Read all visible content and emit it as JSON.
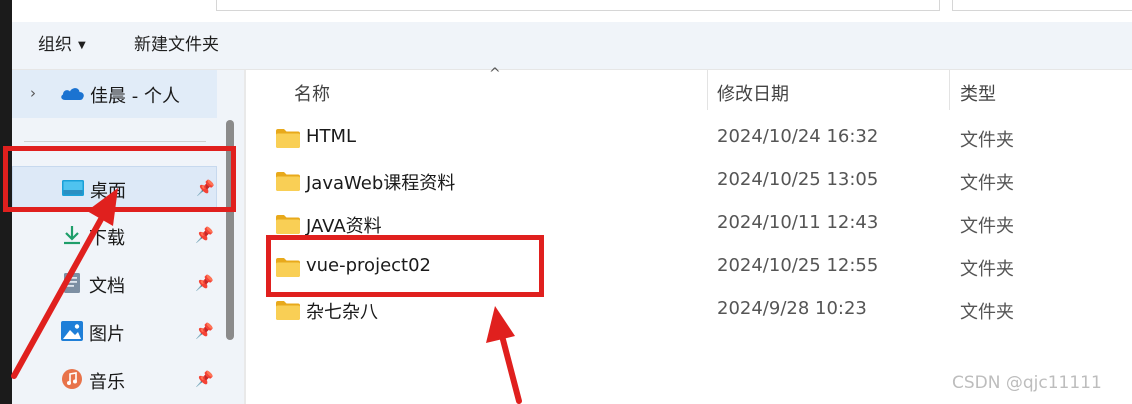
{
  "command_bar": {
    "organize_label": "组织",
    "new_folder_label": "新建文件夹"
  },
  "nav": {
    "onedrive": {
      "label": "佳晨 - 个人",
      "icon": "onedrive-cloud-icon"
    },
    "quick_access": [
      {
        "label": "桌面",
        "icon": "desktop-icon",
        "pinned": true,
        "selected": true
      },
      {
        "label": "下载",
        "icon": "download-icon",
        "pinned": true
      },
      {
        "label": "文档",
        "icon": "documents-icon",
        "pinned": true
      },
      {
        "label": "图片",
        "icon": "pictures-icon",
        "pinned": true
      },
      {
        "label": "音乐",
        "icon": "music-icon",
        "pinned": true
      }
    ]
  },
  "columns": {
    "name": "名称",
    "date": "修改日期",
    "type": "类型"
  },
  "files": [
    {
      "name": "HTML",
      "date": "2024/10/24 16:32",
      "type": "文件夹"
    },
    {
      "name": "JavaWeb课程资料",
      "date": "2024/10/25 13:05",
      "type": "文件夹"
    },
    {
      "name": "JAVA资料",
      "date": "2024/10/11 12:43",
      "type": "文件夹"
    },
    {
      "name": "vue-project02",
      "date": "2024/10/25 12:55",
      "type": "文件夹"
    },
    {
      "name": "杂七杂八",
      "date": "2024/9/28 10:23",
      "type": "文件夹"
    }
  ],
  "watermark": "CSDN @qjc11111",
  "colors": {
    "annotation_red": "#e0201e",
    "folder_yellow": "#f5c443",
    "nav_bg": "#f0f4f9",
    "selection_bg": "#dde9f7"
  }
}
